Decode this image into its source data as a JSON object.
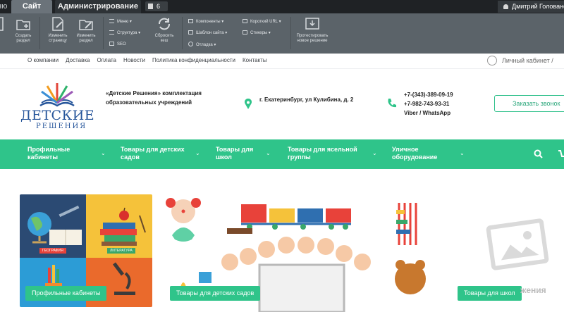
{
  "admin": {
    "tab_cut": "ню",
    "tab_site": "Сайт",
    "tab_admin": "Администрирование",
    "notifications": "6",
    "user_name": "Дмитрий Голованов",
    "buttons": {
      "create_section": "Создать раздел",
      "edit_page": "Изменить страницу",
      "edit_section": "Изменить раздел",
      "reset_cache": "Сбросить кеш",
      "test_new": "Протестировать новое решение"
    },
    "menu_rows": {
      "menu": "Меню",
      "structure": "Структура",
      "seo": "SEO",
      "components": "Компоненты",
      "template": "Шаблон сайта",
      "debug": "Отладка",
      "short_url": "Короткий URL",
      "stickers": "Стикеры"
    }
  },
  "topnav": {
    "links": [
      "О компании",
      "Доставка",
      "Оплата",
      "Новости",
      "Политика конфиденциальности",
      "Контакты"
    ],
    "cabinet": "Личный кабинет"
  },
  "header": {
    "logo_word1": "ДЕТСКИЕ",
    "logo_word2": "РЕШЕНИЯ",
    "tagline": "«Детские Решения» комплектация образовательных учреждений",
    "address": "г. Екатеринбург, ул Кулибина, д. 2",
    "phone1": "+7-(343)-389-09-19",
    "phone2": "+7-982-743-93-31",
    "phone_note": "Viber / WhatsApp",
    "call_button": "Заказать звонок"
  },
  "menu": {
    "items": [
      "Профильные кабинеты",
      "Товары для детских садов",
      "Товары для школ",
      "Товары для ясельной группы",
      "Уличное оборудование"
    ]
  },
  "banners": {
    "b1": "Профильные кабинеты",
    "b1_geo": "ГЕОГРАФИЯ",
    "b1_lit": "ЛИТЕРАТУРА",
    "b2": "Товары для детских садов",
    "b3": "Товары для школ",
    "placeholder": "жения"
  },
  "colors": {
    "accent": "#2fc48a",
    "admin_bg": "#5b6369",
    "brand_blue": "#27569b"
  }
}
